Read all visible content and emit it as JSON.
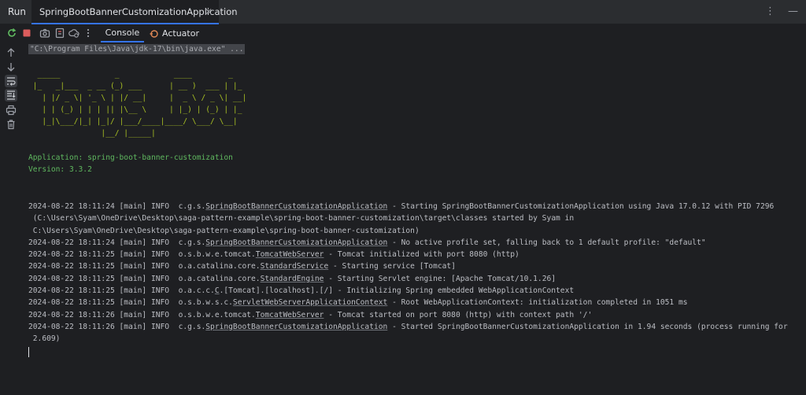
{
  "header": {
    "run_label": "Run",
    "tab_title": "SpringBootBannerCustomizationApplication",
    "close_glyph": "✕",
    "more_glyph": "⋮",
    "minimize_glyph": "—"
  },
  "toolbar": {
    "console_label": "Console",
    "actuator_label": "Actuator"
  },
  "colors": {
    "accent": "#3574f0",
    "stop": "#db5c5c",
    "rerun": "#5fb85f",
    "banner": "#a8c023"
  },
  "console": {
    "command": "\"C:\\Program Files\\Java\\jdk-17\\bin\\java.exe\" ...",
    "banner_lines": [
      "  _____            _            ____        _   ",
      " |_   _|___  _ __ (_) ___      | __ )  ___ | |_ ",
      "   | |/ _ \\| '_ \\ | |/ __|     |  _ \\ / _ \\| __|",
      "   | | (_) | | | || |\\__ \\     | |_) | (_) | |_ ",
      "   |_|\\___/|_| |_|/ |___/____|____/ \\___/ \\__|",
      "                |__/ |_____|                    "
    ],
    "app_line": "Application: spring-boot-banner-customization",
    "version_line": "Version: 3.3.2",
    "log_lines": [
      {
        "pre": "2024-08-22 18:11:24 [main] INFO  c.g.s.",
        "link": "SpringBootBannerCustomizationApplication",
        "post": " - Starting SpringBootBannerCustomizationApplication using Java 17.0.12 with PID 7296"
      },
      {
        "pre": " (C:\\Users\\Syam\\OneDrive\\Desktop\\saga-pattern-example\\spring-boot-banner-customization\\target\\classes started by Syam in",
        "link": "",
        "post": ""
      },
      {
        "pre": " C:\\Users\\Syam\\OneDrive\\Desktop\\saga-pattern-example\\spring-boot-banner-customization)",
        "link": "",
        "post": ""
      },
      {
        "pre": "2024-08-22 18:11:24 [main] INFO  c.g.s.",
        "link": "SpringBootBannerCustomizationApplication",
        "post": " - No active profile set, falling back to 1 default profile: \"default\""
      },
      {
        "pre": "2024-08-22 18:11:25 [main] INFO  o.s.b.w.e.tomcat.",
        "link": "TomcatWebServer",
        "post": " - Tomcat initialized with port 8080 (http)"
      },
      {
        "pre": "2024-08-22 18:11:25 [main] INFO  o.a.catalina.core.",
        "link": "StandardService",
        "post": " - Starting service [Tomcat]"
      },
      {
        "pre": "2024-08-22 18:11:25 [main] INFO  o.a.catalina.core.",
        "link": "StandardEngine",
        "post": " - Starting Servlet engine: [Apache Tomcat/10.1.26]"
      },
      {
        "pre": "2024-08-22 18:11:25 [main] INFO  o.a.c.c.",
        "link": "C",
        "post": ".[Tomcat].[localhost].[/] - Initializing Spring embedded WebApplicationContext"
      },
      {
        "pre": "2024-08-22 18:11:25 [main] INFO  o.s.b.w.s.c.",
        "link": "ServletWebServerApplicationContext",
        "post": " - Root WebApplicationContext: initialization completed in 1051 ms"
      },
      {
        "pre": "2024-08-22 18:11:26 [main] INFO  o.s.b.w.e.tomcat.",
        "link": "TomcatWebServer",
        "post": " - Tomcat started on port 8080 (http) with context path '/'"
      },
      {
        "pre": "2024-08-22 18:11:26 [main] INFO  c.g.s.",
        "link": "SpringBootBannerCustomizationApplication",
        "post": " - Started SpringBootBannerCustomizationApplication in 1.94 seconds (process running for"
      },
      {
        "pre": " 2.609)",
        "link": "",
        "post": ""
      }
    ]
  }
}
